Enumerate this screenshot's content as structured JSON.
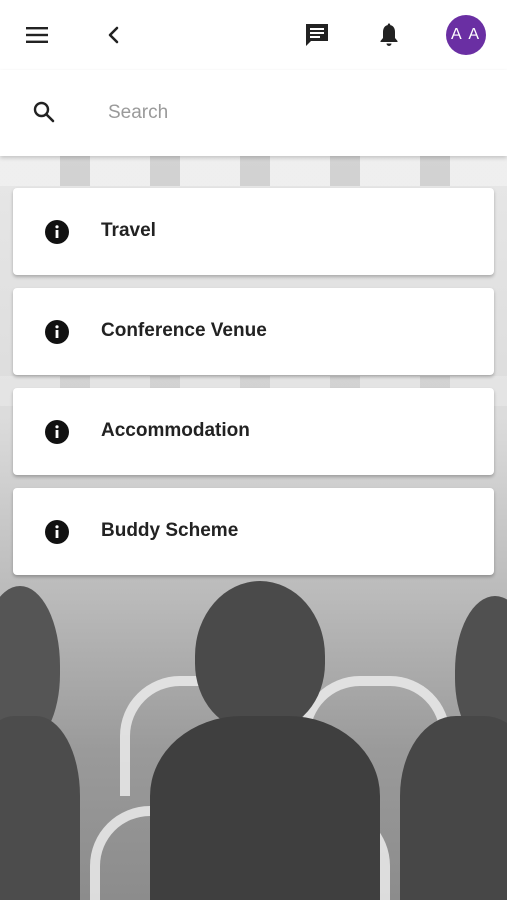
{
  "header": {
    "menu_icon": "hamburger-menu-icon",
    "back_icon": "chevron-left-icon",
    "chat_icon": "chat-icon",
    "notification_icon": "bell-icon",
    "avatar_initials": "A A",
    "avatar_color": "#6a2fa3"
  },
  "search": {
    "placeholder": "Search",
    "value": "",
    "icon": "search-icon"
  },
  "menu": {
    "items": [
      {
        "label": "Travel",
        "icon": "info-icon"
      },
      {
        "label": "Conference Venue",
        "icon": "info-icon"
      },
      {
        "label": "Accommodation",
        "icon": "info-icon"
      },
      {
        "label": "Buddy Scheme",
        "icon": "info-icon"
      }
    ]
  }
}
